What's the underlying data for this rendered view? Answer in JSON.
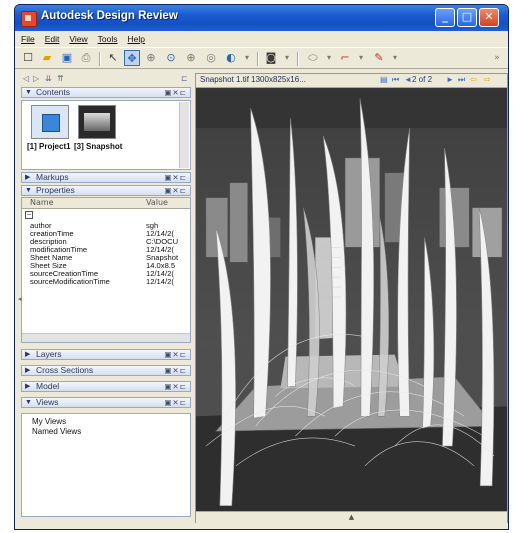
{
  "window": {
    "title": "Autodesk Design Review",
    "controls": [
      "_",
      "□",
      "✕"
    ]
  },
  "menu": [
    "File",
    "Edit",
    "View",
    "Tools",
    "Help"
  ],
  "toolbar": {
    "prev_next_glyphs": [
      "◄",
      "►"
    ]
  },
  "left_panel": {
    "contents": {
      "label": "Contents",
      "items": [
        {
          "label": "[1] Project1"
        },
        {
          "label": "[3] Snapshot"
        }
      ]
    },
    "markups": {
      "label": "Markups"
    },
    "properties": {
      "label": "Properties",
      "columns": {
        "name": "Name",
        "value": "Value"
      },
      "rows": [
        {
          "name": "author",
          "value": "sgh"
        },
        {
          "name": "creationTime",
          "value": "12/14/2("
        },
        {
          "name": "description",
          "value": "C:\\DOCU"
        },
        {
          "name": "modificationTime",
          "value": "12/14/2("
        },
        {
          "name": "Sheet Name",
          "value": "Snapshot"
        },
        {
          "name": "Sheet Size",
          "value": "14.0x8.5"
        },
        {
          "name": "sourceCreationTime",
          "value": "12/14/2("
        },
        {
          "name": "sourceModificationTime",
          "value": "12/14/2("
        }
      ]
    },
    "layers": {
      "label": "Layers"
    },
    "cross_sections": {
      "label": "Cross Sections"
    },
    "model": {
      "label": "Model"
    },
    "views": {
      "label": "Views",
      "items": [
        "My Views",
        "Named Views"
      ]
    }
  },
  "viewer": {
    "caption": "Snapshot 1.tif 1300x825x16...",
    "page_indicator": "2 of 2",
    "footer_glyph": "▲"
  },
  "colors": {
    "title_bar": "#1550c4",
    "window_bg": "#ece9d8",
    "scene_bg": "#3a3a3a"
  }
}
